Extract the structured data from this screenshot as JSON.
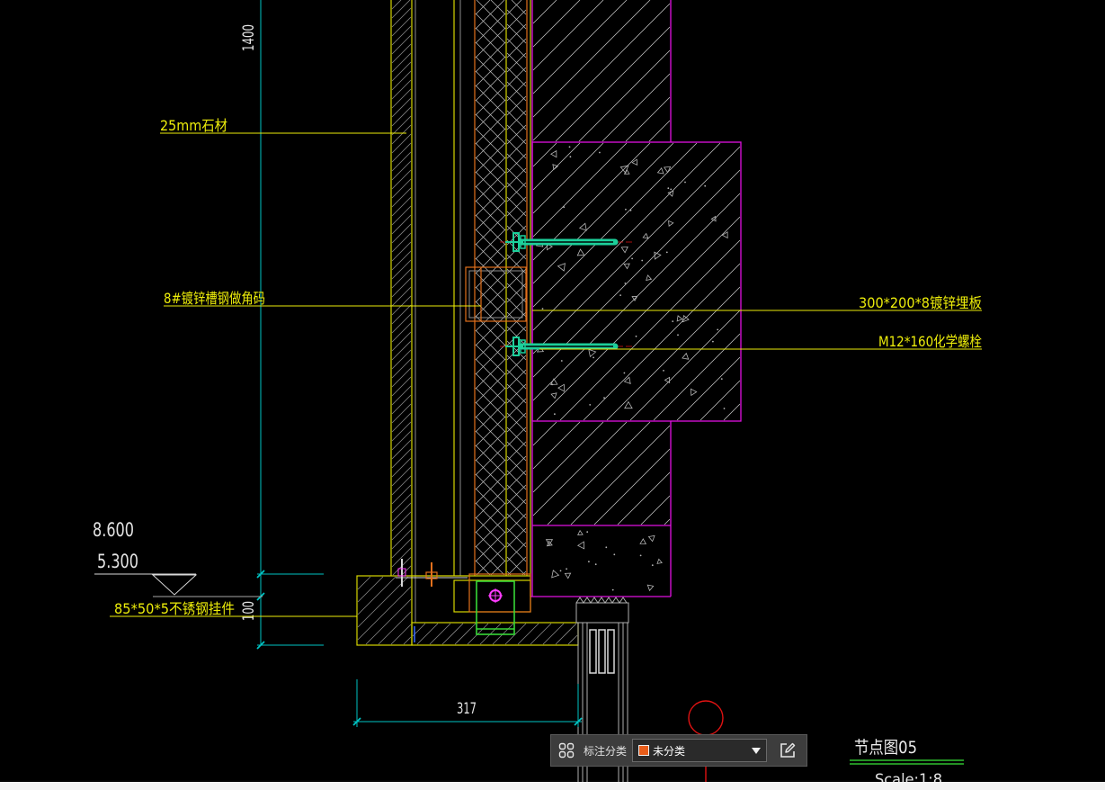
{
  "drawing": {
    "dimensions": {
      "top_vertical": "1400",
      "bottom_vertical": "100",
      "horizontal": "317"
    },
    "elevations": {
      "upper": "8.600",
      "lower": "5.300"
    },
    "labels": {
      "stone": "25mm石材",
      "channel_bracket": "8#镀锌槽钢做角码",
      "embedded_plate": "300*200*8镀锌埋板",
      "chemical_bolt": "M12*160化学螺栓",
      "hanger": "85*50*5不锈钢挂件"
    },
    "title_block": {
      "title": "节点图05",
      "scale": "Scale:1:8"
    }
  },
  "toolbar": {
    "grid_icon": "grid-icon",
    "category_label": "标注分类",
    "category_value": "未分类",
    "category_color": "#e85d1a",
    "dropdown_icon": "chevron-down-icon",
    "edit_icon": "edit-icon"
  },
  "colors": {
    "canvas_background": "#000000",
    "annotation_yellow": "#eded0a",
    "dimension_cyan": "#00c4c4",
    "wall_magenta": "#e010e0",
    "bolt_teal": "#1ccf9a",
    "title_underline_green": "#2fbf2f",
    "marker_red": "#e01212"
  }
}
